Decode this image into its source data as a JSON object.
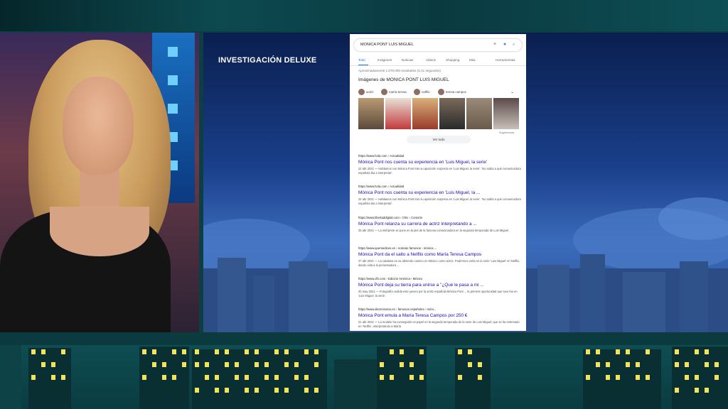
{
  "caption": "INVESTIGACIÓN DELUXE",
  "search": {
    "query": "MONICA PONT LUIS MIGUEL",
    "icons": [
      "close-icon",
      "mic-icon",
      "search-icon"
    ],
    "tabs": [
      {
        "label": "Todo",
        "active": true
      },
      {
        "label": "Imágenes"
      },
      {
        "label": "Noticias"
      },
      {
        "label": "Videos"
      },
      {
        "label": "Shopping"
      },
      {
        "label": "Más"
      },
      {
        "label": "Herramientas"
      }
    ],
    "result_stats": "Aproximadamente 1.070.000 resultados (0,41 segundos)",
    "images_heading": "Imágenes de MONICA PONT LUIS MIGUEL",
    "chips": [
      "actriz",
      "maría teresa",
      "netflix",
      "teresa campos"
    ],
    "image_attribution": "Sugerencias",
    "see_all": "Ver todo",
    "results": [
      {
        "url": "https://www.hola.com › Actualidad",
        "title": "Mónica Pont nos cuenta su experiencia en 'Luis Miguel, la serie'",
        "snippet": "24 abr 2021 — Hablamos con Mónica Pont tras su aparición sorpresa en 'Luis Miguel, la serie'. 'No sabía a qué comunicadora española iba a interpretar'."
      },
      {
        "url": "https://www.hola.com › Actualidad",
        "title": "Mónica Pont nos cuenta su experiencia en 'Luis Miguel, la ...",
        "snippet": "24 abr 2021 — Hablamos con Mónica Pont tras su aparición sorpresa en 'Luis Miguel, la serie'. 'No sabía a qué comunicadora española iba a interpretar'."
      },
      {
        "url": "https://www.libertaddigital.com › Chic › Corazón",
        "title": "Mónica Pont relanza su carrera de actriz interpretando a ...",
        "snippet": "25 abr 2021 — La intérprete se pone en la piel de la famosa comunicadora en la segunda temporada de Luis Miguel."
      },
      {
        "url": "https://www.quemedices.es › noticias famosos › mónica ...",
        "title": "Mónica Pont da el salto a Netflix como María Teresa Campos",
        "snippet": "27 abr 2021 — La catalana se va abriendo camino en México como actriz. Podremos verla en la serie 'Luis Miguel' en Netflix, dando vida a la presentadora ..."
      },
      {
        "url": "https://www.cfb.com › Edición América › México",
        "title": "Mónica Pont deja su tierra para unirse a \"¿Qué le pasa a mi ...",
        "snippet": "20 may 2021 — Fotografía cedida este jueves por la actriz española Mónica Pont ... la primera oportunidad que tuvo fue en 'Luis Miguel, la serie'."
      },
      {
        "url": "https://www.diezminutos.es › famosos españoles › móni...",
        "title": "Mónica Pont emula a María Teresa Campos por 250 €",
        "snippet": "21 abr 2021 — La modelo ha conseguido un papel en la segunda temporada de la serie de Luis Miguel, que se ha estrenado en 'Netflix', interpretando a María"
      }
    ]
  },
  "colors": {
    "link": "#1a0dab",
    "accent": "#1a73e8",
    "frame": "#0c3e43",
    "window_light": "#f2e35a"
  }
}
